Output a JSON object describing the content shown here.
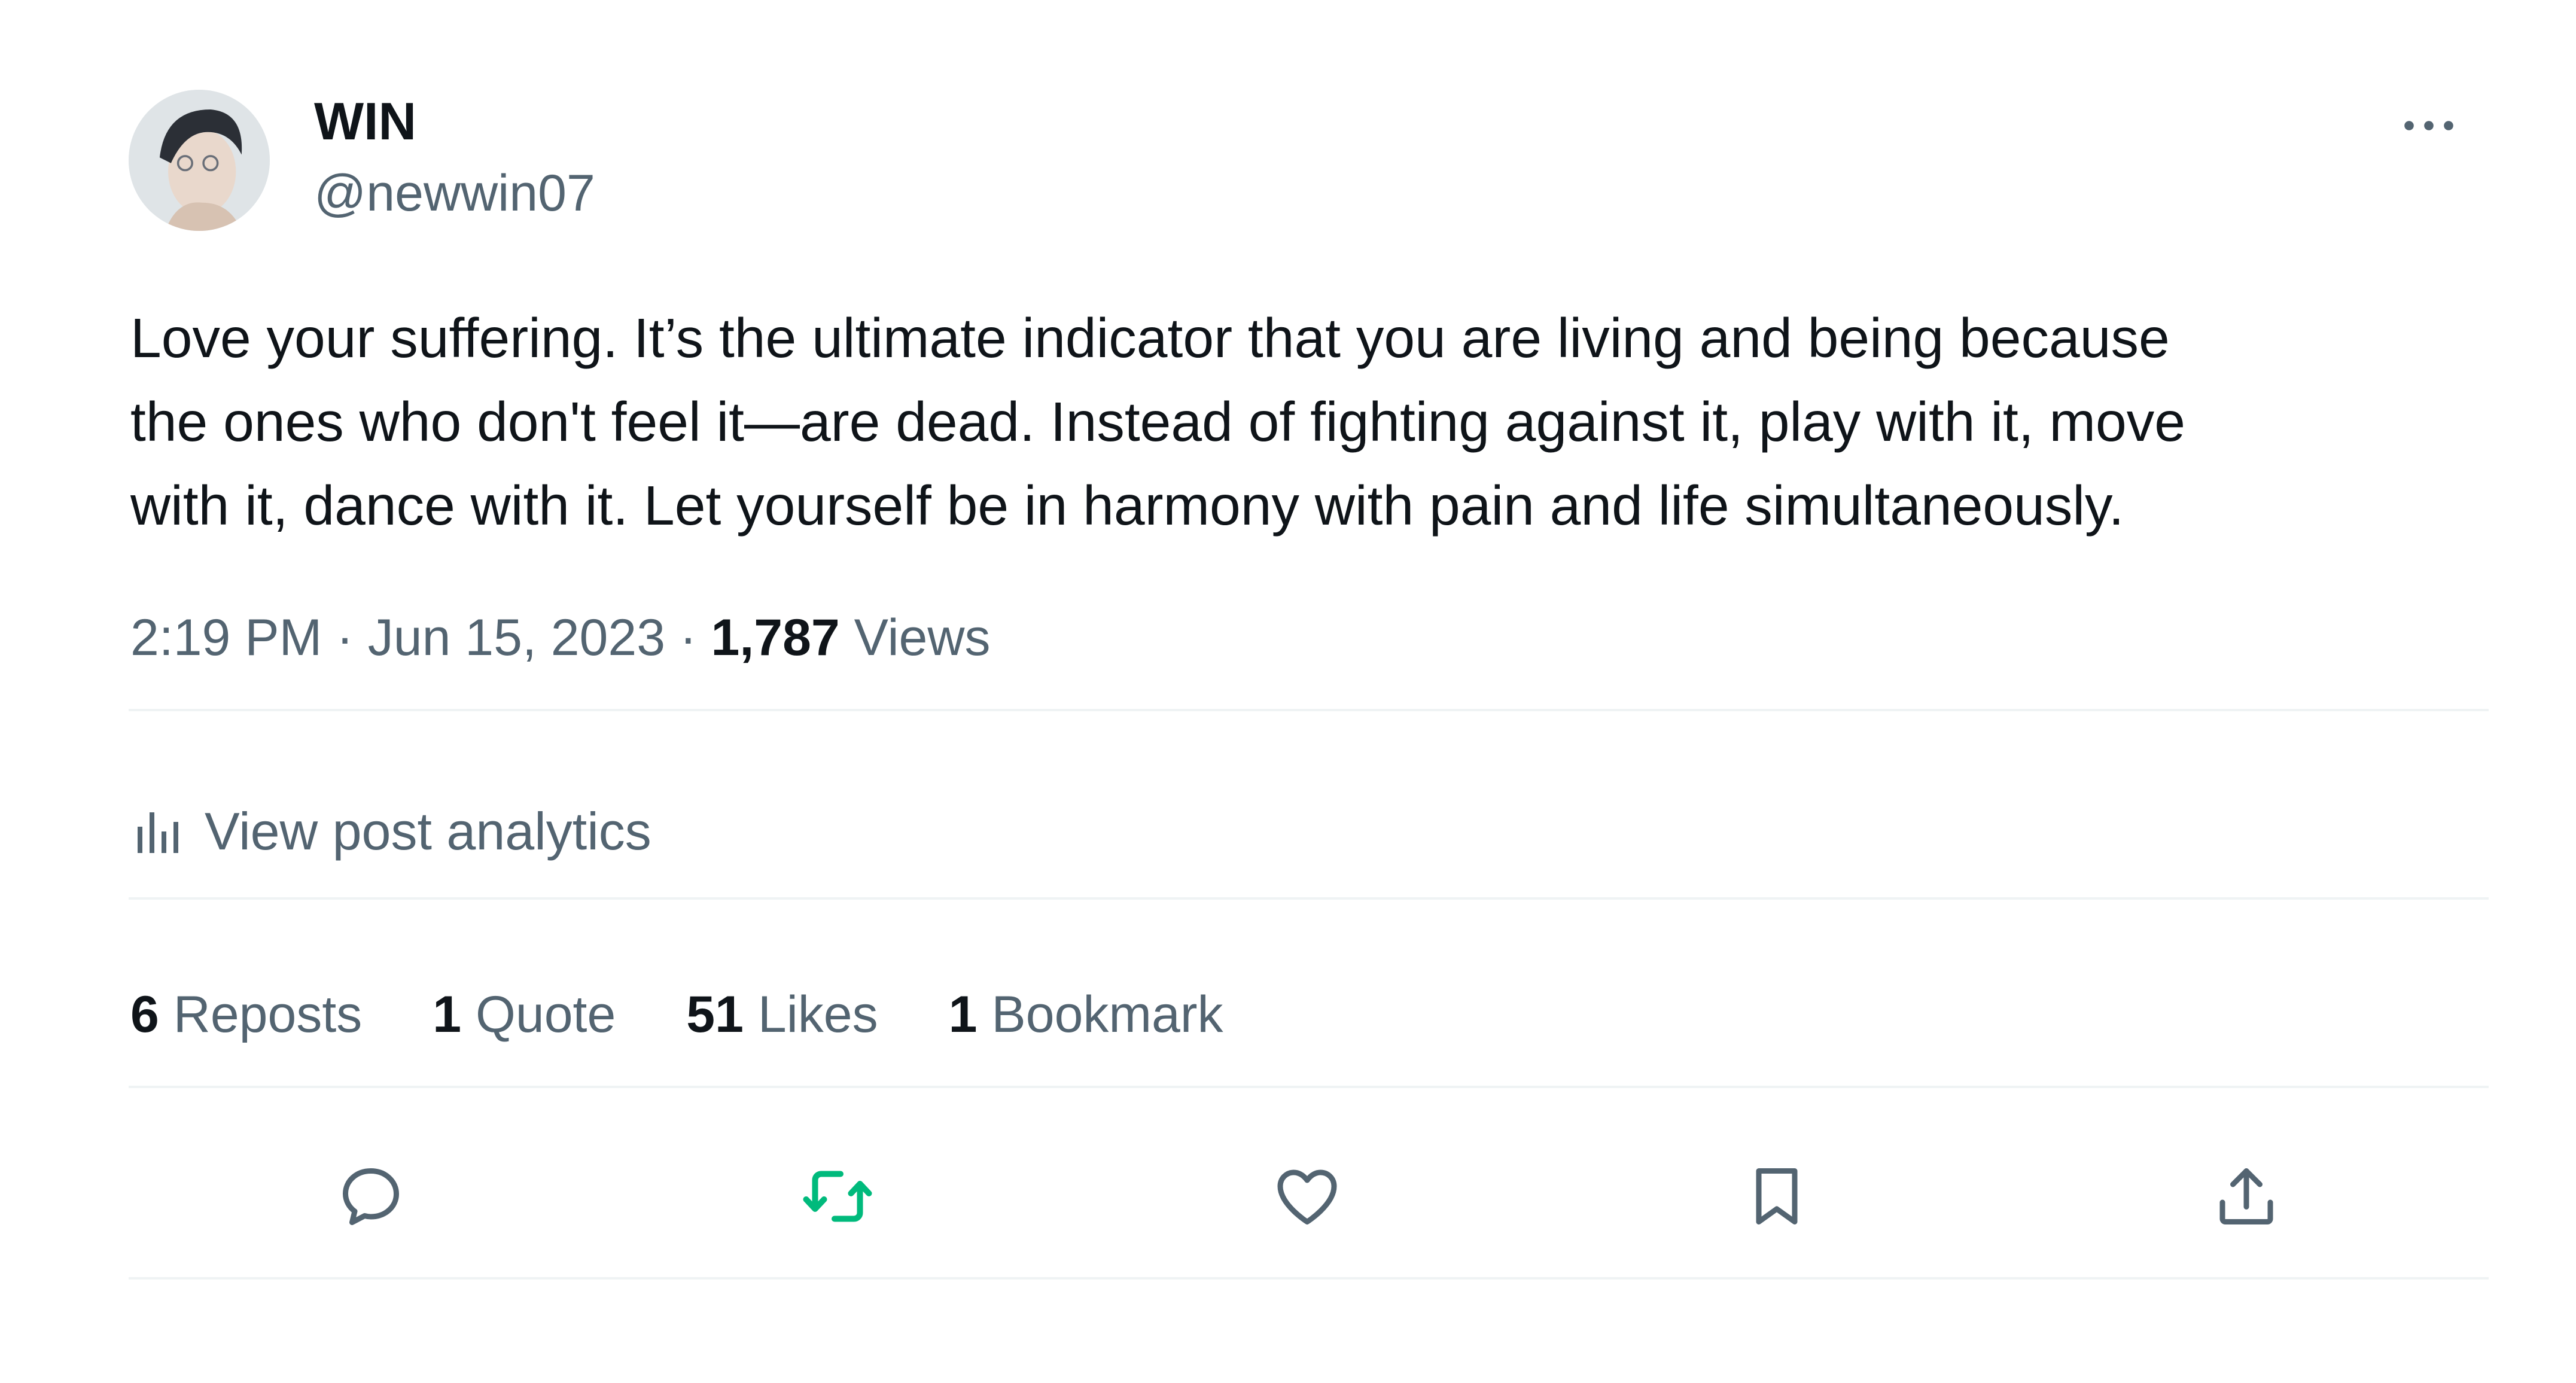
{
  "author": {
    "display_name": "WIN",
    "handle": "@newwin07",
    "avatar_icon": "profile-photo"
  },
  "post": {
    "text": "Love your suffering. It’s the ultimate indicator that you are living and being because\nthe ones who don't feel it—are dead. Instead of fighting against it, play with it, move\nwith it, dance with it. Let yourself be in harmony with pain and life simultaneously.",
    "time": "2:19 PM",
    "separator": "·",
    "date": "Jun 15, 2023",
    "views_count": "1,787",
    "views_label": "Views"
  },
  "analytics": {
    "label": "View post analytics",
    "icon": "bar-chart-icon"
  },
  "stats": [
    {
      "count": "6",
      "label": "Reposts"
    },
    {
      "count": "1",
      "label": "Quote"
    },
    {
      "count": "51",
      "label": "Likes"
    },
    {
      "count": "1",
      "label": "Bookmark"
    }
  ],
  "actions": [
    {
      "name": "reply",
      "icon": "reply-icon"
    },
    {
      "name": "repost",
      "icon": "repost-icon",
      "active": true,
      "color": "#00ba7c"
    },
    {
      "name": "like",
      "icon": "heart-icon"
    },
    {
      "name": "bookmark",
      "icon": "bookmark-icon"
    },
    {
      "name": "share",
      "icon": "share-icon"
    }
  ],
  "colors": {
    "primary_text": "#0f1419",
    "secondary_text": "#536471",
    "divider": "#eff3f4",
    "repost_active": "#00ba7c"
  }
}
